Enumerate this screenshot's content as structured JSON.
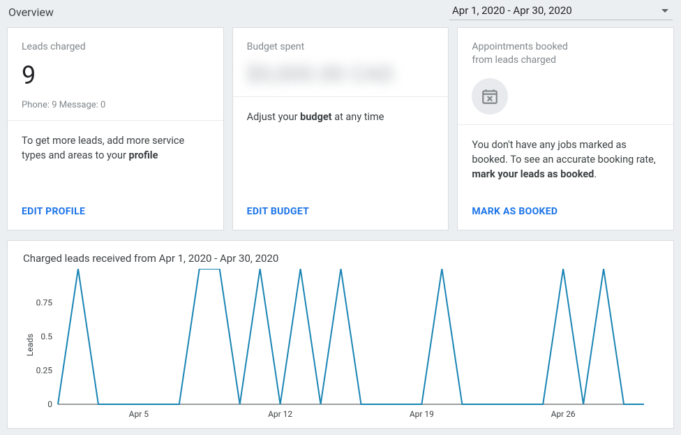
{
  "header": {
    "title": "Overview",
    "date_range": "Apr 1, 2020 - Apr 30, 2020"
  },
  "cards": {
    "leads": {
      "label": "Leads charged",
      "value": "9",
      "subline": "Phone: 9  Message: 0",
      "tip_prefix": "To get more leads, add more service types and areas to your ",
      "tip_bold": "profile",
      "action": "Edit Profile"
    },
    "budget": {
      "label": "Budget spent",
      "hidden_value": "$0,000.00 CAD",
      "tip_prefix": "Adjust your ",
      "tip_bold": "budget",
      "tip_suffix": " at any time",
      "action": "Edit Budget"
    },
    "appts": {
      "label_l1": "Appointments booked",
      "label_l2": "from leads charged",
      "tip_prefix": "You don't have any jobs marked as booked. To see an accurate booking rate, ",
      "tip_bold": "mark your leads as booked",
      "tip_suffix": ".",
      "action": "Mark as Booked"
    }
  },
  "chart": {
    "title": "Charged leads received from Apr 1, 2020 - Apr 30, 2020",
    "ylabel": "Leads"
  },
  "chart_data": {
    "type": "line",
    "title": "Charged leads received from Apr 1, 2020 - Apr 30, 2020",
    "xlabel": "",
    "ylabel": "Leads",
    "ylim": [
      0,
      1
    ],
    "yticks": [
      0,
      0.25,
      0.5,
      0.75
    ],
    "xticks": [
      "Apr 5",
      "Apr 12",
      "Apr 19",
      "Apr 26"
    ],
    "x": [
      "Apr 1",
      "Apr 2",
      "Apr 3",
      "Apr 4",
      "Apr 5",
      "Apr 6",
      "Apr 7",
      "Apr 8",
      "Apr 9",
      "Apr 10",
      "Apr 11",
      "Apr 12",
      "Apr 13",
      "Apr 14",
      "Apr 15",
      "Apr 16",
      "Apr 17",
      "Apr 18",
      "Apr 19",
      "Apr 20",
      "Apr 21",
      "Apr 22",
      "Apr 23",
      "Apr 24",
      "Apr 25",
      "Apr 26",
      "Apr 27",
      "Apr 28",
      "Apr 29",
      "Apr 30"
    ],
    "values": [
      0,
      1,
      0,
      0,
      0,
      0,
      0,
      1,
      1,
      0,
      1,
      0,
      1,
      0,
      1,
      0,
      0,
      0,
      0,
      1,
      0,
      0,
      0,
      0,
      0,
      1,
      0,
      1,
      0,
      0
    ]
  }
}
